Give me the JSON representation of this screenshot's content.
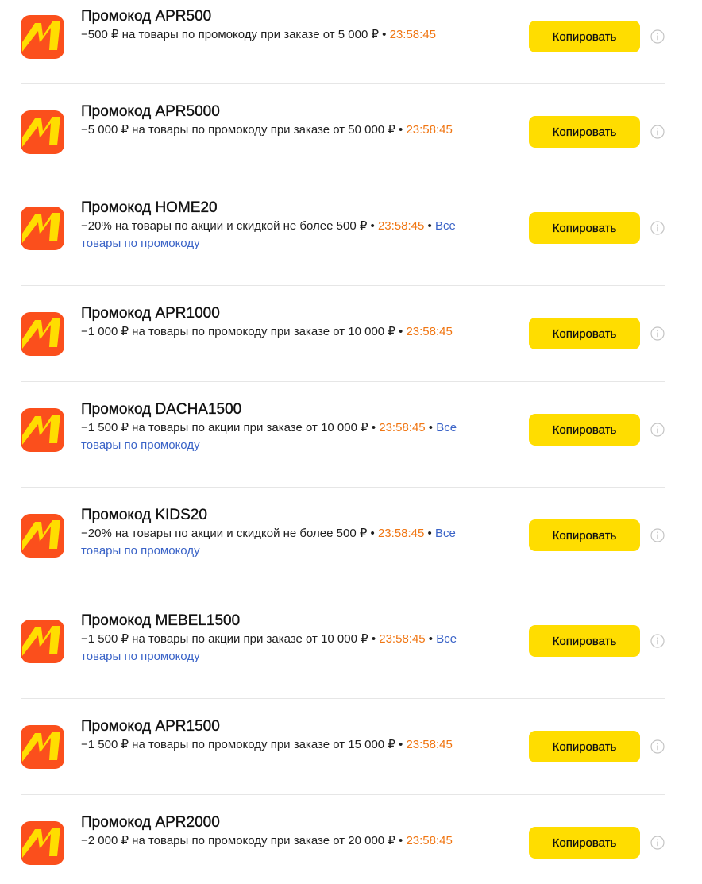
{
  "copy_label": "Копировать",
  "colors": {
    "brand_logo": "#fb4f1c",
    "logo_mark": "#ffdd00",
    "button": "#ffdd00",
    "timer": "#f07613",
    "link": "#3a63c7"
  },
  "icons": {
    "logo": "yandex-market-logo-icon",
    "info": "info-icon"
  },
  "promos": [
    {
      "title": "Промокод APR500",
      "description": "−500 ₽ на товары по промокоду при заказе от 5 000 ₽",
      "timer": "23:58:45",
      "link": ""
    },
    {
      "title": "Промокод APR5000",
      "description": "−5 000 ₽ на товары по промокоду при заказе от 50 000 ₽",
      "timer": "23:58:45",
      "link": ""
    },
    {
      "title": "Промокод HOME20",
      "description": "−20% на товары по акции и скидкой не более 500 ₽",
      "timer": "23:58:45",
      "link": "Все товары по промокоду"
    },
    {
      "title": "Промокод APR1000",
      "description": "−1 000 ₽ на товары по промокоду при заказе от 10 000 ₽",
      "timer": "23:58:45",
      "link": ""
    },
    {
      "title": "Промокод DACHA1500",
      "description": "−1 500 ₽ на товары по акции при заказе от 10 000 ₽",
      "timer": "23:58:45",
      "link": "Все товары по промокоду"
    },
    {
      "title": "Промокод KIDS20",
      "description": "−20% на товары по акции и скидкой не более 500 ₽",
      "timer": "23:58:45",
      "link": "Все товары по промокоду"
    },
    {
      "title": "Промокод MEBEL1500",
      "description": "−1 500 ₽ на товары по акции при заказе от 10 000 ₽",
      "timer": "23:58:45",
      "link": "Все товары по промокоду"
    },
    {
      "title": "Промокод APR1500",
      "description": "−1 500 ₽ на товары по промокоду при заказе от 15 000 ₽",
      "timer": "23:58:45",
      "link": ""
    },
    {
      "title": "Промокод APR2000",
      "description": "−2 000 ₽ на товары по промокоду при заказе от 20 000 ₽",
      "timer": "23:58:45",
      "link": ""
    }
  ]
}
